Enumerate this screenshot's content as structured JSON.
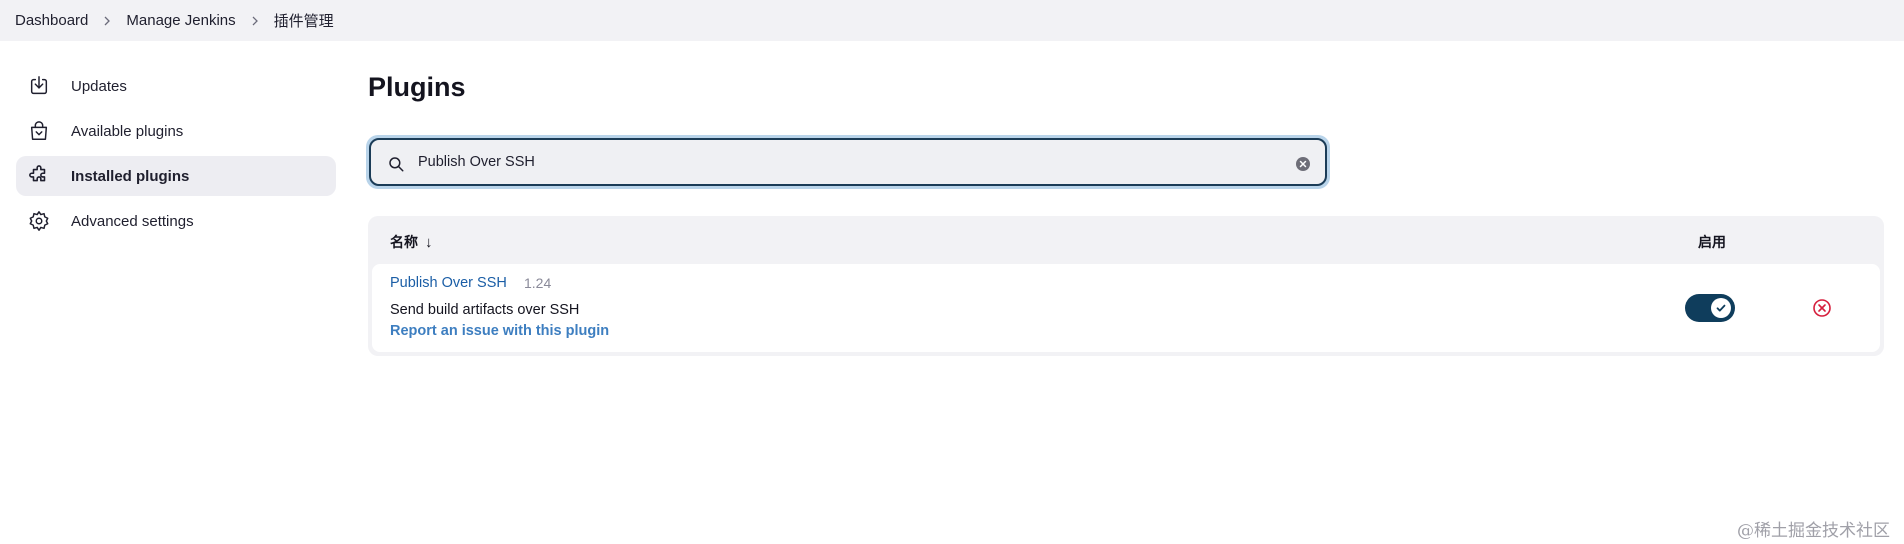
{
  "breadcrumb": {
    "items": [
      "Dashboard",
      "Manage Jenkins",
      "插件管理"
    ]
  },
  "sidebar": {
    "items": [
      {
        "label": "Updates",
        "icon": "download-icon",
        "active": false
      },
      {
        "label": "Available plugins",
        "icon": "shopping-bag-icon",
        "active": false
      },
      {
        "label": "Installed plugins",
        "icon": "puzzle-icon",
        "active": true
      },
      {
        "label": "Advanced settings",
        "icon": "gear-icon",
        "active": false
      }
    ]
  },
  "main": {
    "title": "Plugins",
    "search": {
      "value": "Publish Over SSH",
      "placeholder": "",
      "icon": "search-icon",
      "clear_icon": "clear-icon"
    },
    "table": {
      "columns": {
        "name": "名称",
        "sort_indicator": "↓",
        "enabled": "启用"
      },
      "rows": [
        {
          "name": "Publish Over SSH",
          "version": "1.24",
          "description": "Send build artifacts over SSH",
          "report_link": "Report an issue with this plugin",
          "enabled": true
        }
      ]
    }
  },
  "watermark": "@稀土掘金技术社区",
  "colors": {
    "accent": "#0f3d5c",
    "link": "#1b5ea6",
    "danger": "#d61e3c",
    "breadcrumb_bg": "#f2f2f5",
    "search_focus_ring": "#b9d4ea"
  }
}
